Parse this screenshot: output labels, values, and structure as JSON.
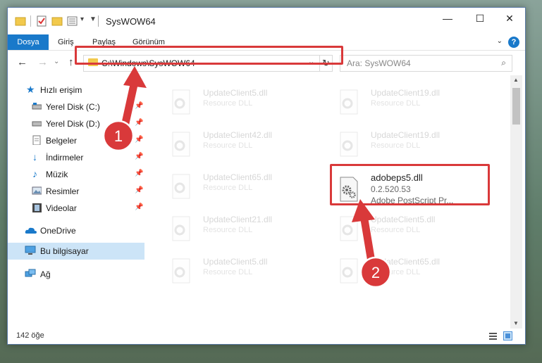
{
  "window": {
    "title": "SysWOW64",
    "controls": {
      "minimize": "—",
      "maximize": "☐",
      "close": "✕"
    }
  },
  "ribbon": {
    "tabs": [
      "Dosya",
      "Giriş",
      "Paylaş",
      "Görünüm"
    ],
    "help": "?"
  },
  "navigation": {
    "back": "←",
    "forward": "→",
    "up": "↑",
    "address": "C:\\Windows\\SysWOW64",
    "refresh": "↻",
    "search_placeholder": "Ara: SysWOW64"
  },
  "sidebar": {
    "quick_access": "Hızlı erişim",
    "items": [
      {
        "label": "Yerel Disk (C:)",
        "icon": "drive-icon"
      },
      {
        "label": "Yerel Disk (D:)",
        "icon": "drive-icon"
      },
      {
        "label": "Belgeler",
        "icon": "documents-icon"
      },
      {
        "label": "İndirmeler",
        "icon": "download-icon"
      },
      {
        "label": "Müzik",
        "icon": "music-icon"
      },
      {
        "label": "Resimler",
        "icon": "pictures-icon"
      },
      {
        "label": "Videolar",
        "icon": "video-icon"
      }
    ],
    "onedrive": "OneDrive",
    "this_pc": "Bu bilgisayar",
    "network": "Ağ"
  },
  "files": {
    "left": [
      {
        "name": "UpdateClient5.dll",
        "type": "Resource DLL"
      },
      {
        "name": "UpdateClient42.dll",
        "type": "Resource DLL"
      },
      {
        "name": "UpdateClient65.dll",
        "type": "Resource DLL"
      },
      {
        "name": "UpdateClient21.dll",
        "type": "Resource DLL"
      },
      {
        "name": "UpdateClient5.dll",
        "type": "Resource DLL"
      }
    ],
    "right": [
      {
        "name": "UpdateClient19.dll",
        "type": "Resource DLL"
      },
      {
        "name": "UpdateClient19.dll",
        "type": "Resource DLL"
      },
      {
        "name": "adobeps5.dll",
        "type": "0.2.520.53",
        "desc": "Adobe PostScript Pr..."
      },
      {
        "name": "UpdateClient5.dll",
        "type": "Resource DLL"
      },
      {
        "name": "UpdateClient65.dll",
        "type": "Resource DLL"
      }
    ]
  },
  "status": {
    "count": "142 öğe"
  },
  "annotations": {
    "step1": "1",
    "step2": "2",
    "color": "#d9393a"
  }
}
